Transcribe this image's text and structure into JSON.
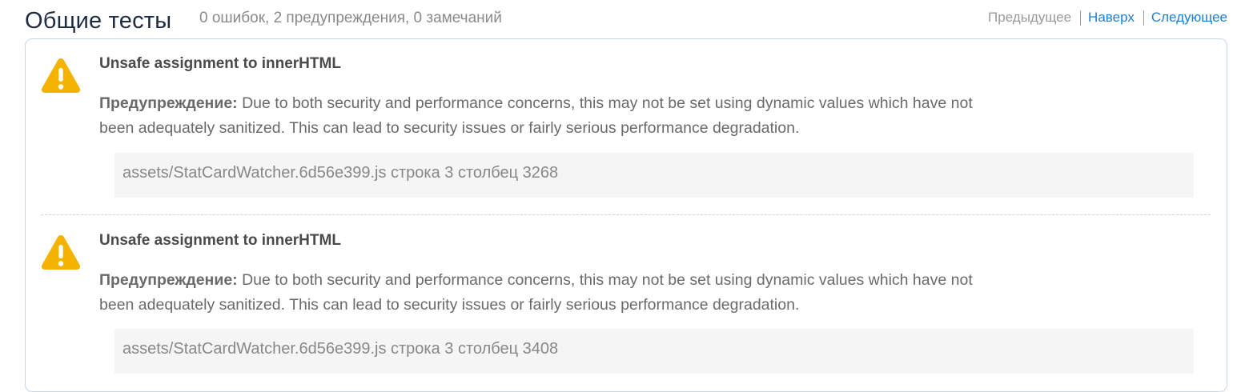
{
  "section": {
    "title": "Общие тесты",
    "summary": "0 ошибок, 2 предупреждения, 0 замечаний"
  },
  "nav": {
    "prev_label": "Предыдущее",
    "top_label": "Наверх",
    "next_label": "Следующее"
  },
  "colors": {
    "warning_icon": "#f3b300",
    "link": "#1e7fd0",
    "panel_border": "#c9d7e6",
    "location_bg": "#f5f5f5"
  },
  "issues": [
    {
      "icon": "warning-triangle-icon",
      "title": "Unsafe assignment to innerHTML",
      "severity_label": "Предупреждение:",
      "description": " Due to both security and performance concerns, this may not be set using dynamic values which have not been adequately sanitized. This can lead to security issues or fairly serious performance degradation.",
      "location": "assets/StatCardWatcher.6d56e399.js строка 3 столбец 3268"
    },
    {
      "icon": "warning-triangle-icon",
      "title": "Unsafe assignment to innerHTML",
      "severity_label": "Предупреждение:",
      "description": " Due to both security and performance concerns, this may not be set using dynamic values which have not been adequately sanitized. This can lead to security issues or fairly serious performance degradation.",
      "location": "assets/StatCardWatcher.6d56e399.js строка 3 столбец 3408"
    }
  ]
}
